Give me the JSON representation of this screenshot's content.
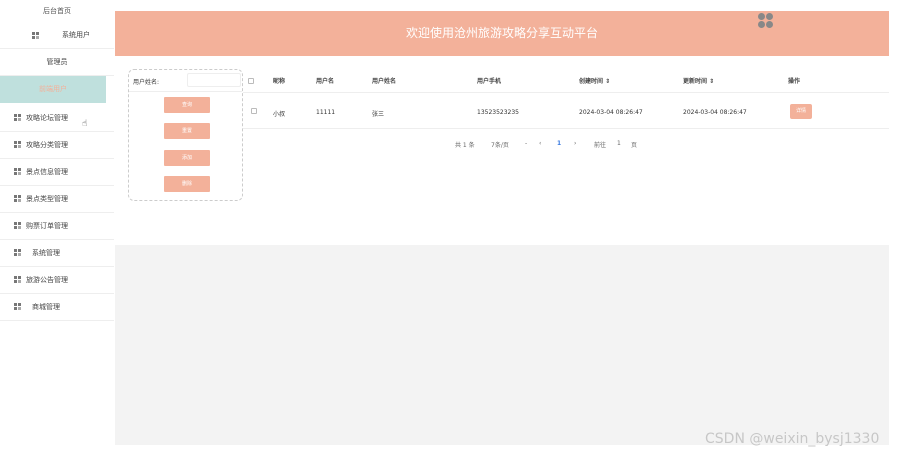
{
  "sidebar": {
    "title": "后台首页",
    "items": [
      {
        "label": "系统用户",
        "icon": "grid-icon"
      },
      {
        "label": "管理员",
        "icon": ""
      },
      {
        "label": "前端用户",
        "icon": ""
      },
      {
        "label": "攻略论坛管理",
        "icon": "grid-icon"
      },
      {
        "label": "攻略分类管理",
        "icon": "grid-icon"
      },
      {
        "label": "景点信息管理",
        "icon": "grid-icon"
      },
      {
        "label": "景点类型管理",
        "icon": "grid-icon"
      },
      {
        "label": "购票订单管理",
        "icon": "grid-icon"
      },
      {
        "label": "系统管理",
        "icon": "grid-icon"
      },
      {
        "label": "旅游公告管理",
        "icon": "grid-icon"
      },
      {
        "label": "商城管理",
        "icon": "grid-icon"
      }
    ]
  },
  "header": {
    "title": "欢迎使用沧州旅游攻略分享互动平台",
    "bg_color": "#f3b19a"
  },
  "search": {
    "label": "用户姓名:",
    "buttons": [
      "查询",
      "重置",
      "添加",
      "删除"
    ]
  },
  "table": {
    "headers": [
      "昵称",
      "用户名",
      "用户姓名",
      "用户手机",
      "创建时间 ⇕",
      "更新时间 ⇕",
      "操作"
    ],
    "rows": [
      {
        "nickname": "小叔",
        "username": "11111",
        "realname": "张三",
        "phone": "13523523235",
        "created": "2024-03-04 08:26:47",
        "updated": "2024-03-04 08:26:47",
        "action": "详情"
      }
    ]
  },
  "pagination": {
    "total": "共 1 条",
    "page_size": "7条/页",
    "prev": "‹",
    "current": "1",
    "next": "›",
    "goto_label": "前往",
    "goto_value": "1",
    "page_unit": "页"
  },
  "watermark": "CSDN @weixin_bysj1330"
}
